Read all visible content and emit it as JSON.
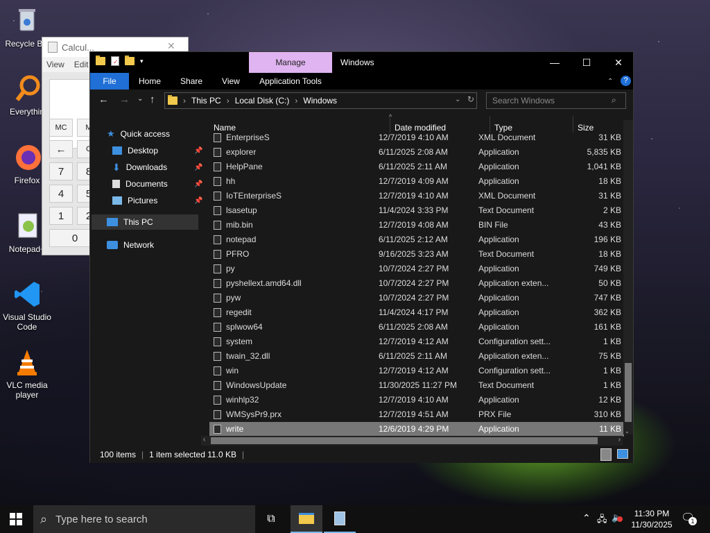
{
  "desktop": {
    "icons": [
      {
        "label": "Recycle Bin",
        "icon": "recycle-bin-icon"
      },
      {
        "label": "Everythin",
        "icon": "everything-icon"
      },
      {
        "label": "Firefox",
        "icon": "firefox-icon"
      },
      {
        "label": "Notepad+",
        "icon": "notepad-plus-icon"
      },
      {
        "label": "Visual Studio Code",
        "icon": "vscode-icon"
      },
      {
        "label": "VLC media player",
        "icon": "vlc-icon"
      }
    ]
  },
  "calculator": {
    "title": "Calcul...",
    "menu": [
      "View",
      "Edit"
    ],
    "buttons": [
      "MC",
      "M",
      "←",
      "C",
      "7",
      "8",
      "4",
      "5",
      "1",
      "2",
      "0"
    ]
  },
  "explorer": {
    "manage_label": "Manage",
    "app_tools_label": "Application Tools",
    "title": "Windows",
    "ribbon_tabs": [
      "File",
      "Home",
      "Share",
      "View"
    ],
    "breadcrumb": [
      "This PC",
      "Local Disk (C:)",
      "Windows"
    ],
    "search_placeholder": "Search Windows",
    "nav": {
      "quick_access": "Quick access",
      "desktop": "Desktop",
      "downloads": "Downloads",
      "documents": "Documents",
      "pictures": "Pictures",
      "this_pc": "This PC",
      "network": "Network"
    },
    "columns": {
      "name": "Name",
      "date": "Date modified",
      "type": "Type",
      "size": "Size"
    },
    "files": [
      {
        "name": "EnterpriseS",
        "date": "12/7/2019 4:10 AM",
        "type": "XML Document",
        "size": "31 KB"
      },
      {
        "name": "explorer",
        "date": "6/11/2025 2:08 AM",
        "type": "Application",
        "size": "5,835 KB"
      },
      {
        "name": "HelpPane",
        "date": "6/11/2025 2:11 AM",
        "type": "Application",
        "size": "1,041 KB"
      },
      {
        "name": "hh",
        "date": "12/7/2019 4:09 AM",
        "type": "Application",
        "size": "18 KB"
      },
      {
        "name": "IoTEnterpriseS",
        "date": "12/7/2019 4:10 AM",
        "type": "XML Document",
        "size": "31 KB"
      },
      {
        "name": "lsasetup",
        "date": "11/4/2024 3:33 PM",
        "type": "Text Document",
        "size": "2 KB"
      },
      {
        "name": "mib.bin",
        "date": "12/7/2019 4:08 AM",
        "type": "BIN File",
        "size": "43 KB"
      },
      {
        "name": "notepad",
        "date": "6/11/2025 2:12 AM",
        "type": "Application",
        "size": "196 KB"
      },
      {
        "name": "PFRO",
        "date": "9/16/2025 3:23 AM",
        "type": "Text Document",
        "size": "18 KB"
      },
      {
        "name": "py",
        "date": "10/7/2024 2:27 PM",
        "type": "Application",
        "size": "749 KB"
      },
      {
        "name": "pyshellext.amd64.dll",
        "date": "10/7/2024 2:27 PM",
        "type": "Application exten...",
        "size": "50 KB"
      },
      {
        "name": "pyw",
        "date": "10/7/2024 2:27 PM",
        "type": "Application",
        "size": "747 KB"
      },
      {
        "name": "regedit",
        "date": "11/4/2024 4:17 PM",
        "type": "Application",
        "size": "362 KB"
      },
      {
        "name": "splwow64",
        "date": "6/11/2025 2:08 AM",
        "type": "Application",
        "size": "161 KB"
      },
      {
        "name": "system",
        "date": "12/7/2019 4:12 AM",
        "type": "Configuration sett...",
        "size": "1 KB"
      },
      {
        "name": "twain_32.dll",
        "date": "6/11/2025 2:11 AM",
        "type": "Application exten...",
        "size": "75 KB"
      },
      {
        "name": "win",
        "date": "12/7/2019 4:12 AM",
        "type": "Configuration sett...",
        "size": "1 KB"
      },
      {
        "name": "WindowsUpdate",
        "date": "11/30/2025 11:27 PM",
        "type": "Text Document",
        "size": "1 KB"
      },
      {
        "name": "winhlp32",
        "date": "12/7/2019 4:10 AM",
        "type": "Application",
        "size": "12 KB"
      },
      {
        "name": "WMSysPr9.prx",
        "date": "12/7/2019 4:51 AM",
        "type": "PRX File",
        "size": "310 KB"
      },
      {
        "name": "write",
        "date": "12/6/2019 4:29 PM",
        "type": "Application",
        "size": "11 KB"
      }
    ],
    "selected_file": "write",
    "status": {
      "items": "100 items",
      "selected": "1 item selected  11.0 KB"
    }
  },
  "taskbar": {
    "search_placeholder": "Type here to search",
    "time": "11:30 PM",
    "date": "11/30/2025",
    "notif_count": "1"
  }
}
